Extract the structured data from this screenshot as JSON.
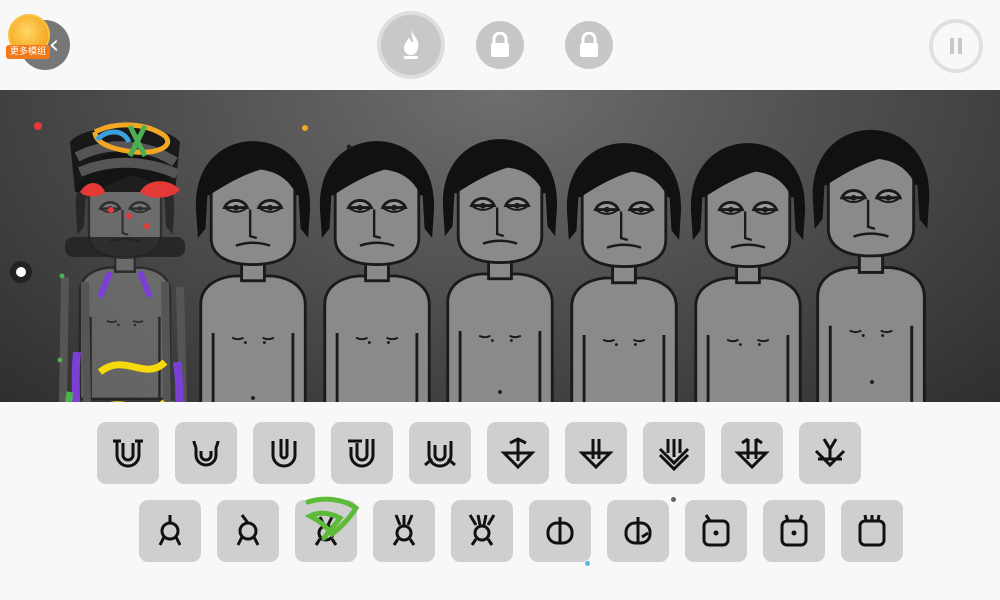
{
  "header": {
    "promo_label": "更多模组",
    "back_icon": "back-icon",
    "fire_icon": "flame-icon",
    "lock_icon": "lock-icon",
    "pause_icon": "pause-icon"
  },
  "stage": {
    "performer_count": 7,
    "performers_state": "idle",
    "active_performer": "scribbled-corrupted"
  },
  "palette": {
    "row1": [
      {
        "name": "beat-u-1"
      },
      {
        "name": "beat-u-2"
      },
      {
        "name": "beat-u-3"
      },
      {
        "name": "beat-u-4"
      },
      {
        "name": "beat-u-5"
      },
      {
        "name": "effect-arrow-1"
      },
      {
        "name": "effect-arrow-2"
      },
      {
        "name": "effect-arrow-3"
      },
      {
        "name": "effect-arrow-4"
      },
      {
        "name": "effect-arrow-5"
      }
    ],
    "row2": [
      {
        "name": "melody-a-1"
      },
      {
        "name": "melody-a-2"
      },
      {
        "name": "melody-a-3"
      },
      {
        "name": "melody-a-4"
      },
      {
        "name": "melody-a-5"
      },
      {
        "name": "voice-b-1"
      },
      {
        "name": "voice-b-2"
      },
      {
        "name": "voice-square-1"
      },
      {
        "name": "voice-square-2"
      },
      {
        "name": "voice-square-3"
      }
    ]
  },
  "colors": {
    "stage_bg": "#4a4a4a",
    "button_bg": "#cfcfcf",
    "icon_stroke": "#111111",
    "scribble_green": "#5dbb3a"
  }
}
